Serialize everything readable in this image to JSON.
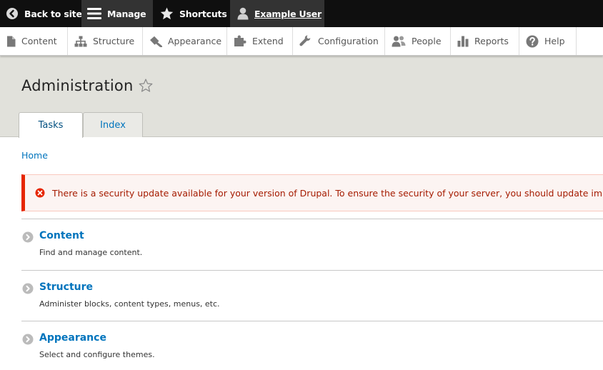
{
  "toolbar": {
    "back": {
      "label": "Back to site",
      "icon": "back-circle-icon"
    },
    "manage": {
      "label": "Manage",
      "icon": "hamburger-menu-icon"
    },
    "shortcuts": {
      "label": "Shortcuts",
      "icon": "star-icon"
    },
    "user": {
      "label": "Example User",
      "icon": "user-icon"
    }
  },
  "tray": {
    "items": [
      {
        "label": "Content",
        "icon": "document-icon"
      },
      {
        "label": "Structure",
        "icon": "sitemap-icon"
      },
      {
        "label": "Appearance",
        "icon": "paint-icon"
      },
      {
        "label": "Extend",
        "icon": "puzzle-icon"
      },
      {
        "label": "Configuration",
        "icon": "wrench-icon"
      },
      {
        "label": "People",
        "icon": "people-icon"
      },
      {
        "label": "Reports",
        "icon": "bar-chart-icon"
      },
      {
        "label": "Help",
        "icon": "help-icon"
      }
    ]
  },
  "page": {
    "title": "Administration",
    "tabs": [
      {
        "label": "Tasks",
        "active": true
      },
      {
        "label": "Index",
        "active": false
      }
    ]
  },
  "breadcrumb": {
    "home": "Home"
  },
  "alert": {
    "message": "There is a security update available for your version of Drupal. To ensure the security of your server, you should update im",
    "color": "#e62600"
  },
  "admin_items": [
    {
      "title": "Content",
      "description": "Find and manage content."
    },
    {
      "title": "Structure",
      "description": "Administer blocks, content types, menus, etc."
    },
    {
      "title": "Appearance",
      "description": "Select and configure themes."
    }
  ],
  "colors": {
    "link": "#0074bd",
    "toolbar_bg": "#0f0f0f",
    "header_bg": "#e1e1db",
    "error": "#e62600"
  }
}
